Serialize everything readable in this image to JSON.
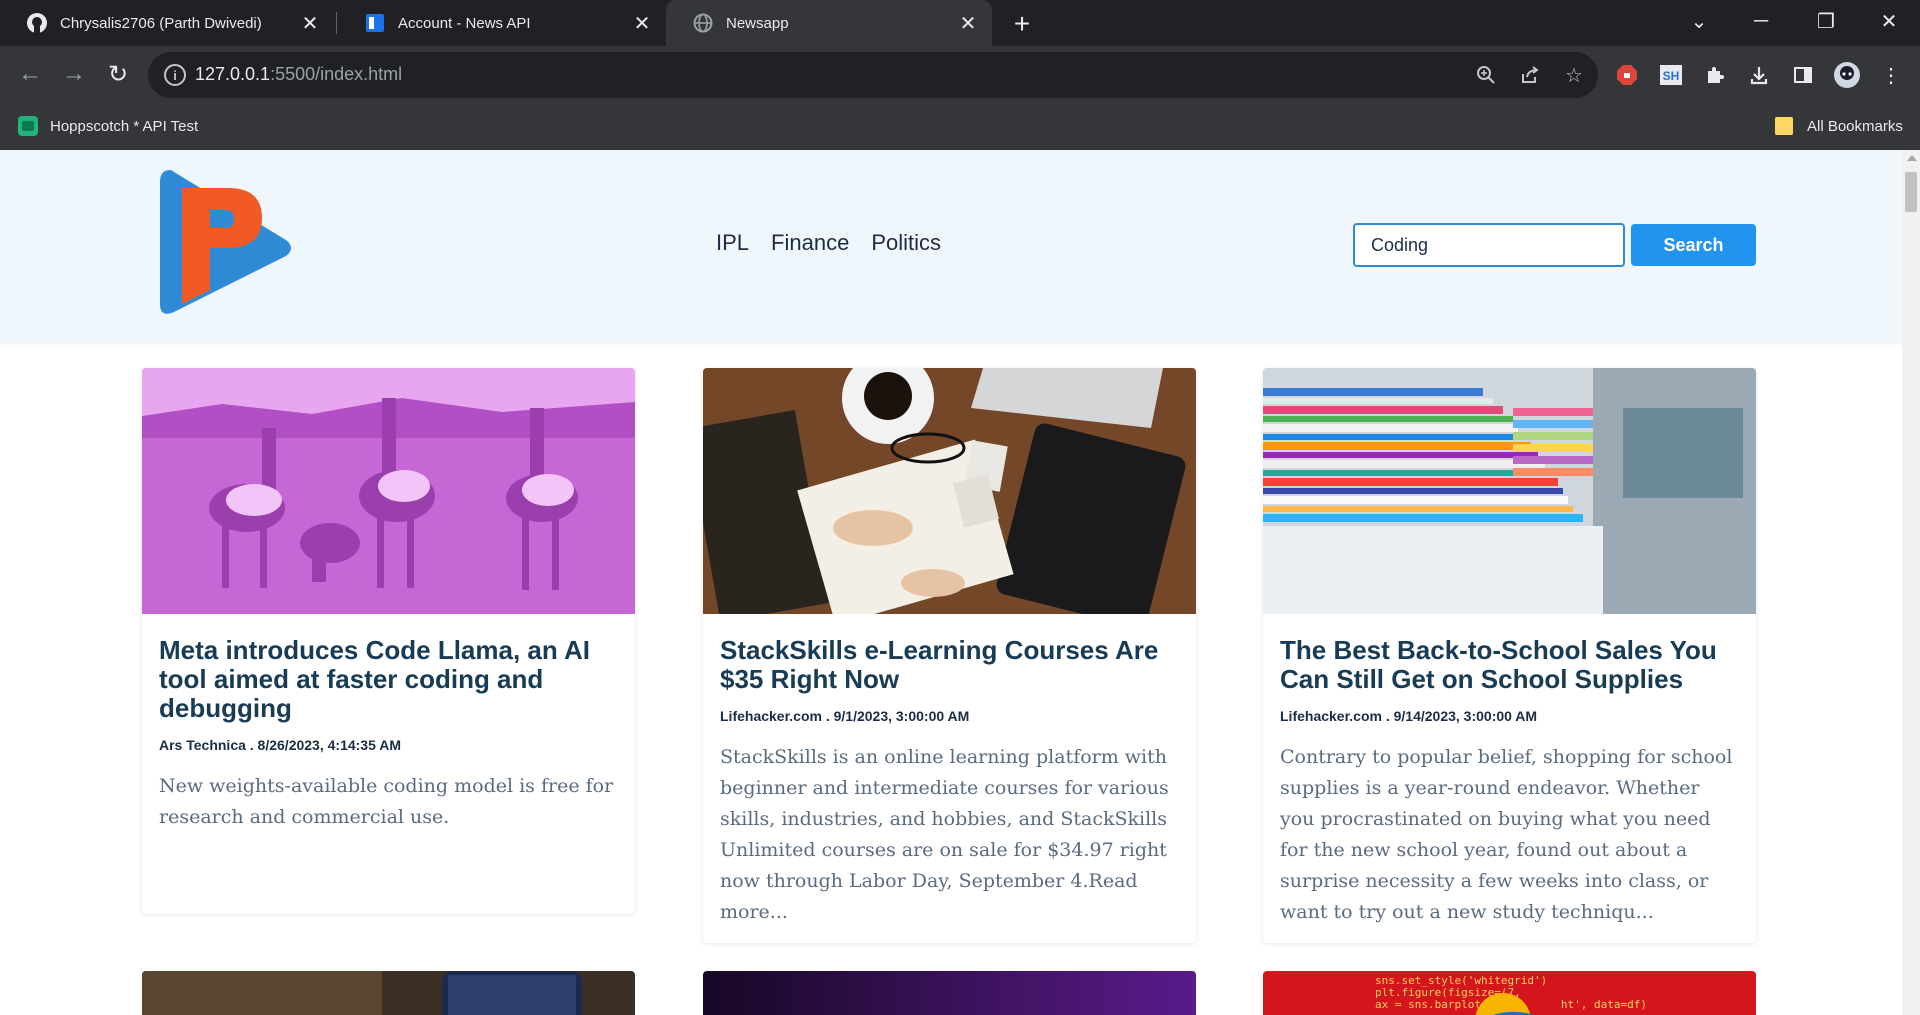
{
  "browser": {
    "tabs": [
      {
        "title": "Chrysalis2706 (Parth Dwivedi)",
        "icon": "github-icon"
      },
      {
        "title": "Account - News API",
        "icon": "newsapi-icon"
      },
      {
        "title": "Newsapp",
        "icon": "globe-icon",
        "active": true
      }
    ],
    "address": {
      "host": "127.0.0.1",
      "rest": ":5500/index.html"
    },
    "bookmarks": {
      "left": "Hoppscotch * API Test",
      "right": "All Bookmarks"
    }
  },
  "site": {
    "nav": [
      "IPL",
      "Finance",
      "Politics"
    ],
    "search": {
      "value": "Coding",
      "button": "Search"
    },
    "brand_colors": {
      "blue": "#2f8bd6",
      "red": "#f15a24",
      "button": "#2294ed"
    }
  },
  "articles": [
    {
      "title": "Meta introduces Code Llama, an AI tool aimed at faster coding and debugging",
      "meta": "Ars Technica . 8/26/2023, 4:14:35 AM",
      "description": "New weights-available coding model is free for research and commercial use."
    },
    {
      "title": "StackSkills e-Learning Courses Are $35 Right Now",
      "meta": "Lifehacker.com . 9/1/2023, 3:00:00 AM",
      "description": "StackSkills is an online learning platform with beginner and intermediate courses for various skills, industries, and hobbies, and StackSkills Unlimited courses are on sale for $34.97 right now through Labor Day, September 4.Read more..."
    },
    {
      "title": "The Best Back-to-School Sales You Can Still Get on School Supplies",
      "meta": "Lifehacker.com . 9/14/2023, 3:00:00 AM",
      "description": "Contrary to popular belief, shopping for school supplies is a year-round endeavor. Whether you procrastinated on buying what you need for the new school year, found out about a surprise necessity a few weeks into class, or want to try out a new study techniqu..."
    }
  ],
  "partial_card_code": [
    "sns.set_style('whitegrid')",
    "plt.figure(figsize=(7,",
    "ax = sns.barplot(x=",
    "ht', data=df)"
  ]
}
